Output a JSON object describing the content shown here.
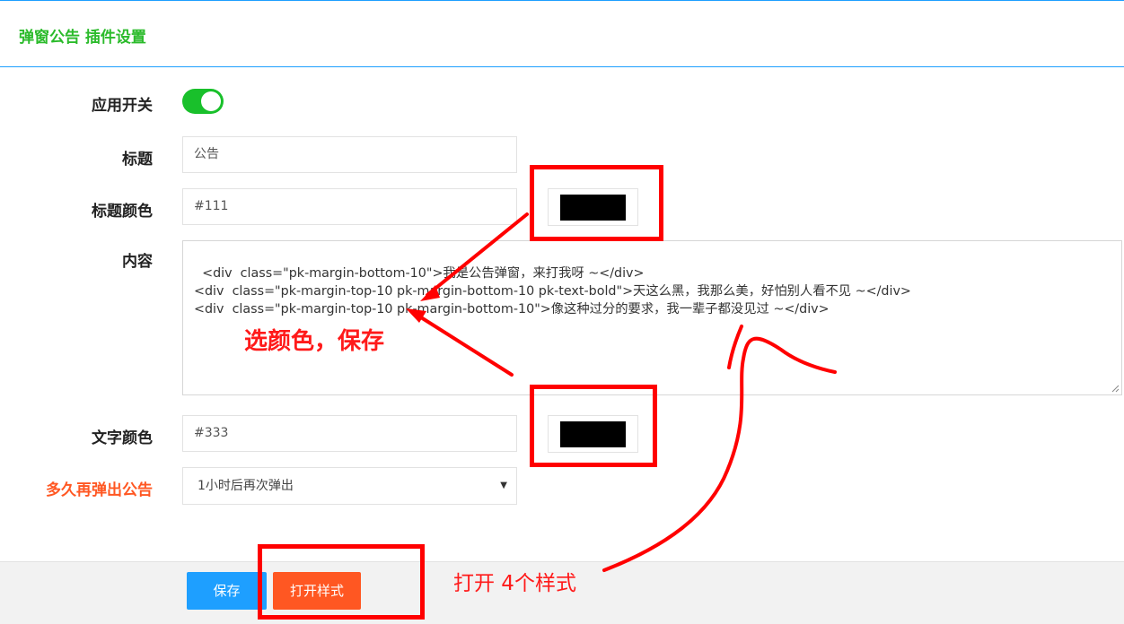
{
  "header": {
    "title": "弹窗公告 插件设置"
  },
  "form": {
    "enable_label": "应用开关",
    "enabled": true,
    "title_label": "标题",
    "title_value": "公告",
    "title_color_label": "标题颜色",
    "title_color_value": "#111",
    "content_label": "内容",
    "content_value": "<div  class=\"pk-margin-bottom-10\">我是公告弹窗，来打我呀 ~</div>\n<div  class=\"pk-margin-top-10 pk-margin-bottom-10 pk-text-bold\">天这么黑，我那么美，好怕别人看不见 ~</div>\n<div  class=\"pk-margin-top-10 pk-margin-bottom-10\">像这种过分的要求，我一辈子都没见过 ~</div>",
    "text_color_label": "文字颜色",
    "text_color_value": "#333",
    "repopup_label": "多久再弹出公告",
    "repopup_value": "1小时后再次弹出"
  },
  "buttons": {
    "save": "保存",
    "open_style": "打开样式"
  },
  "annotations": {
    "pick_color_note": "选颜色，保存",
    "open_styles_note": "打开 4个样式"
  },
  "colors": {
    "accent_blue": "#1e9fff",
    "accent_green": "#19c02b",
    "accent_orange": "#ff5722",
    "annotation_red": "#ff0000",
    "swatch_title": "#000000",
    "swatch_text": "#000000"
  }
}
